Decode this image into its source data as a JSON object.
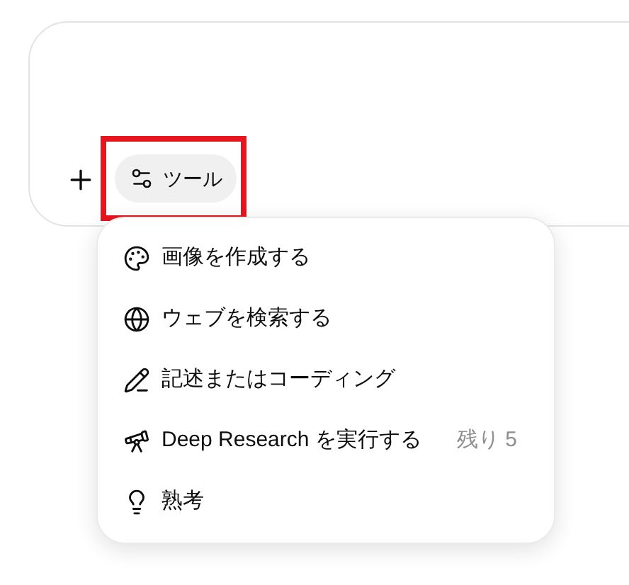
{
  "composer": {
    "tools_button": {
      "label": "ツール",
      "highlighted": true
    }
  },
  "tools_menu": {
    "items": [
      {
        "label": "画像を作成する"
      },
      {
        "label": "ウェブを検索する"
      },
      {
        "label": "記述またはコーディング"
      },
      {
        "label": "Deep Research を実行する",
        "badge": "残り 5"
      },
      {
        "label": "熟考"
      }
    ]
  }
}
